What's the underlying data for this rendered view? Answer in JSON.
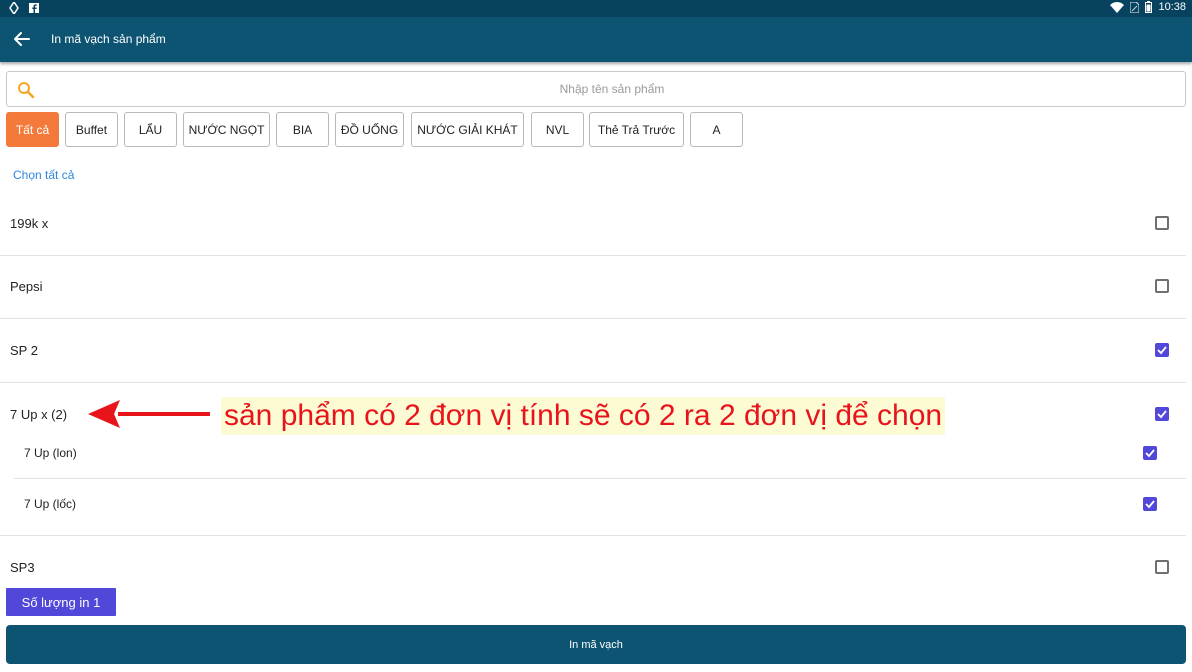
{
  "statusbar": {
    "time": "10:38",
    "icons": [
      "location-icon",
      "facebook-icon",
      "wifi-icon",
      "sim-icon",
      "battery-icon"
    ]
  },
  "appbar": {
    "title": "In mã vạch sản phẩm",
    "back_icon": "arrow-left-icon"
  },
  "search": {
    "placeholder": "Nhập tên sản phẩm",
    "value": "",
    "icon": "search-icon",
    "icon_color": "#f5a623"
  },
  "categories": [
    {
      "label": "Tất cả",
      "active": true
    },
    {
      "label": "Buffet",
      "active": false
    },
    {
      "label": "LẨU",
      "active": false
    },
    {
      "label": "NƯỚC NGỌT",
      "active": false
    },
    {
      "label": "BIA",
      "active": false
    },
    {
      "label": "ĐỒ UỐNG",
      "active": false
    },
    {
      "label": "NƯỚC GIẢI KHÁT",
      "active": false
    },
    {
      "label": "NVL",
      "active": false
    },
    {
      "label": "Thẻ Trả Trước",
      "active": false
    },
    {
      "label": "A",
      "active": false
    }
  ],
  "select_all_label": "Chọn tất cả",
  "products": [
    {
      "name": "199k x",
      "checked": false,
      "level": 0
    },
    {
      "name": "Pepsi",
      "checked": false,
      "level": 0
    },
    {
      "name": "SP 2",
      "checked": true,
      "level": 0
    },
    {
      "name": "7 Up x (2)",
      "checked": true,
      "level": 0
    },
    {
      "name": "7 Up (lon)",
      "checked": true,
      "level": 1
    },
    {
      "name": "7 Up (lốc)",
      "checked": true,
      "level": 1
    },
    {
      "name": "SP3",
      "checked": false,
      "level": 0
    }
  ],
  "quantity_button": "Số lượng in 1",
  "print_button": "In mã vạch",
  "annotation": {
    "text": "sản phẩm có 2 đơn vị tính sẽ có 2 ra 2 đơn vị để chọn",
    "color": "#e8141b",
    "background": "#fcfbd4"
  },
  "colors": {
    "appbar": "#0d5473",
    "statusbar": "#07425e",
    "accent_orange": "#f47a3c",
    "checkbox": "#5147d9",
    "link": "#2e86de"
  }
}
